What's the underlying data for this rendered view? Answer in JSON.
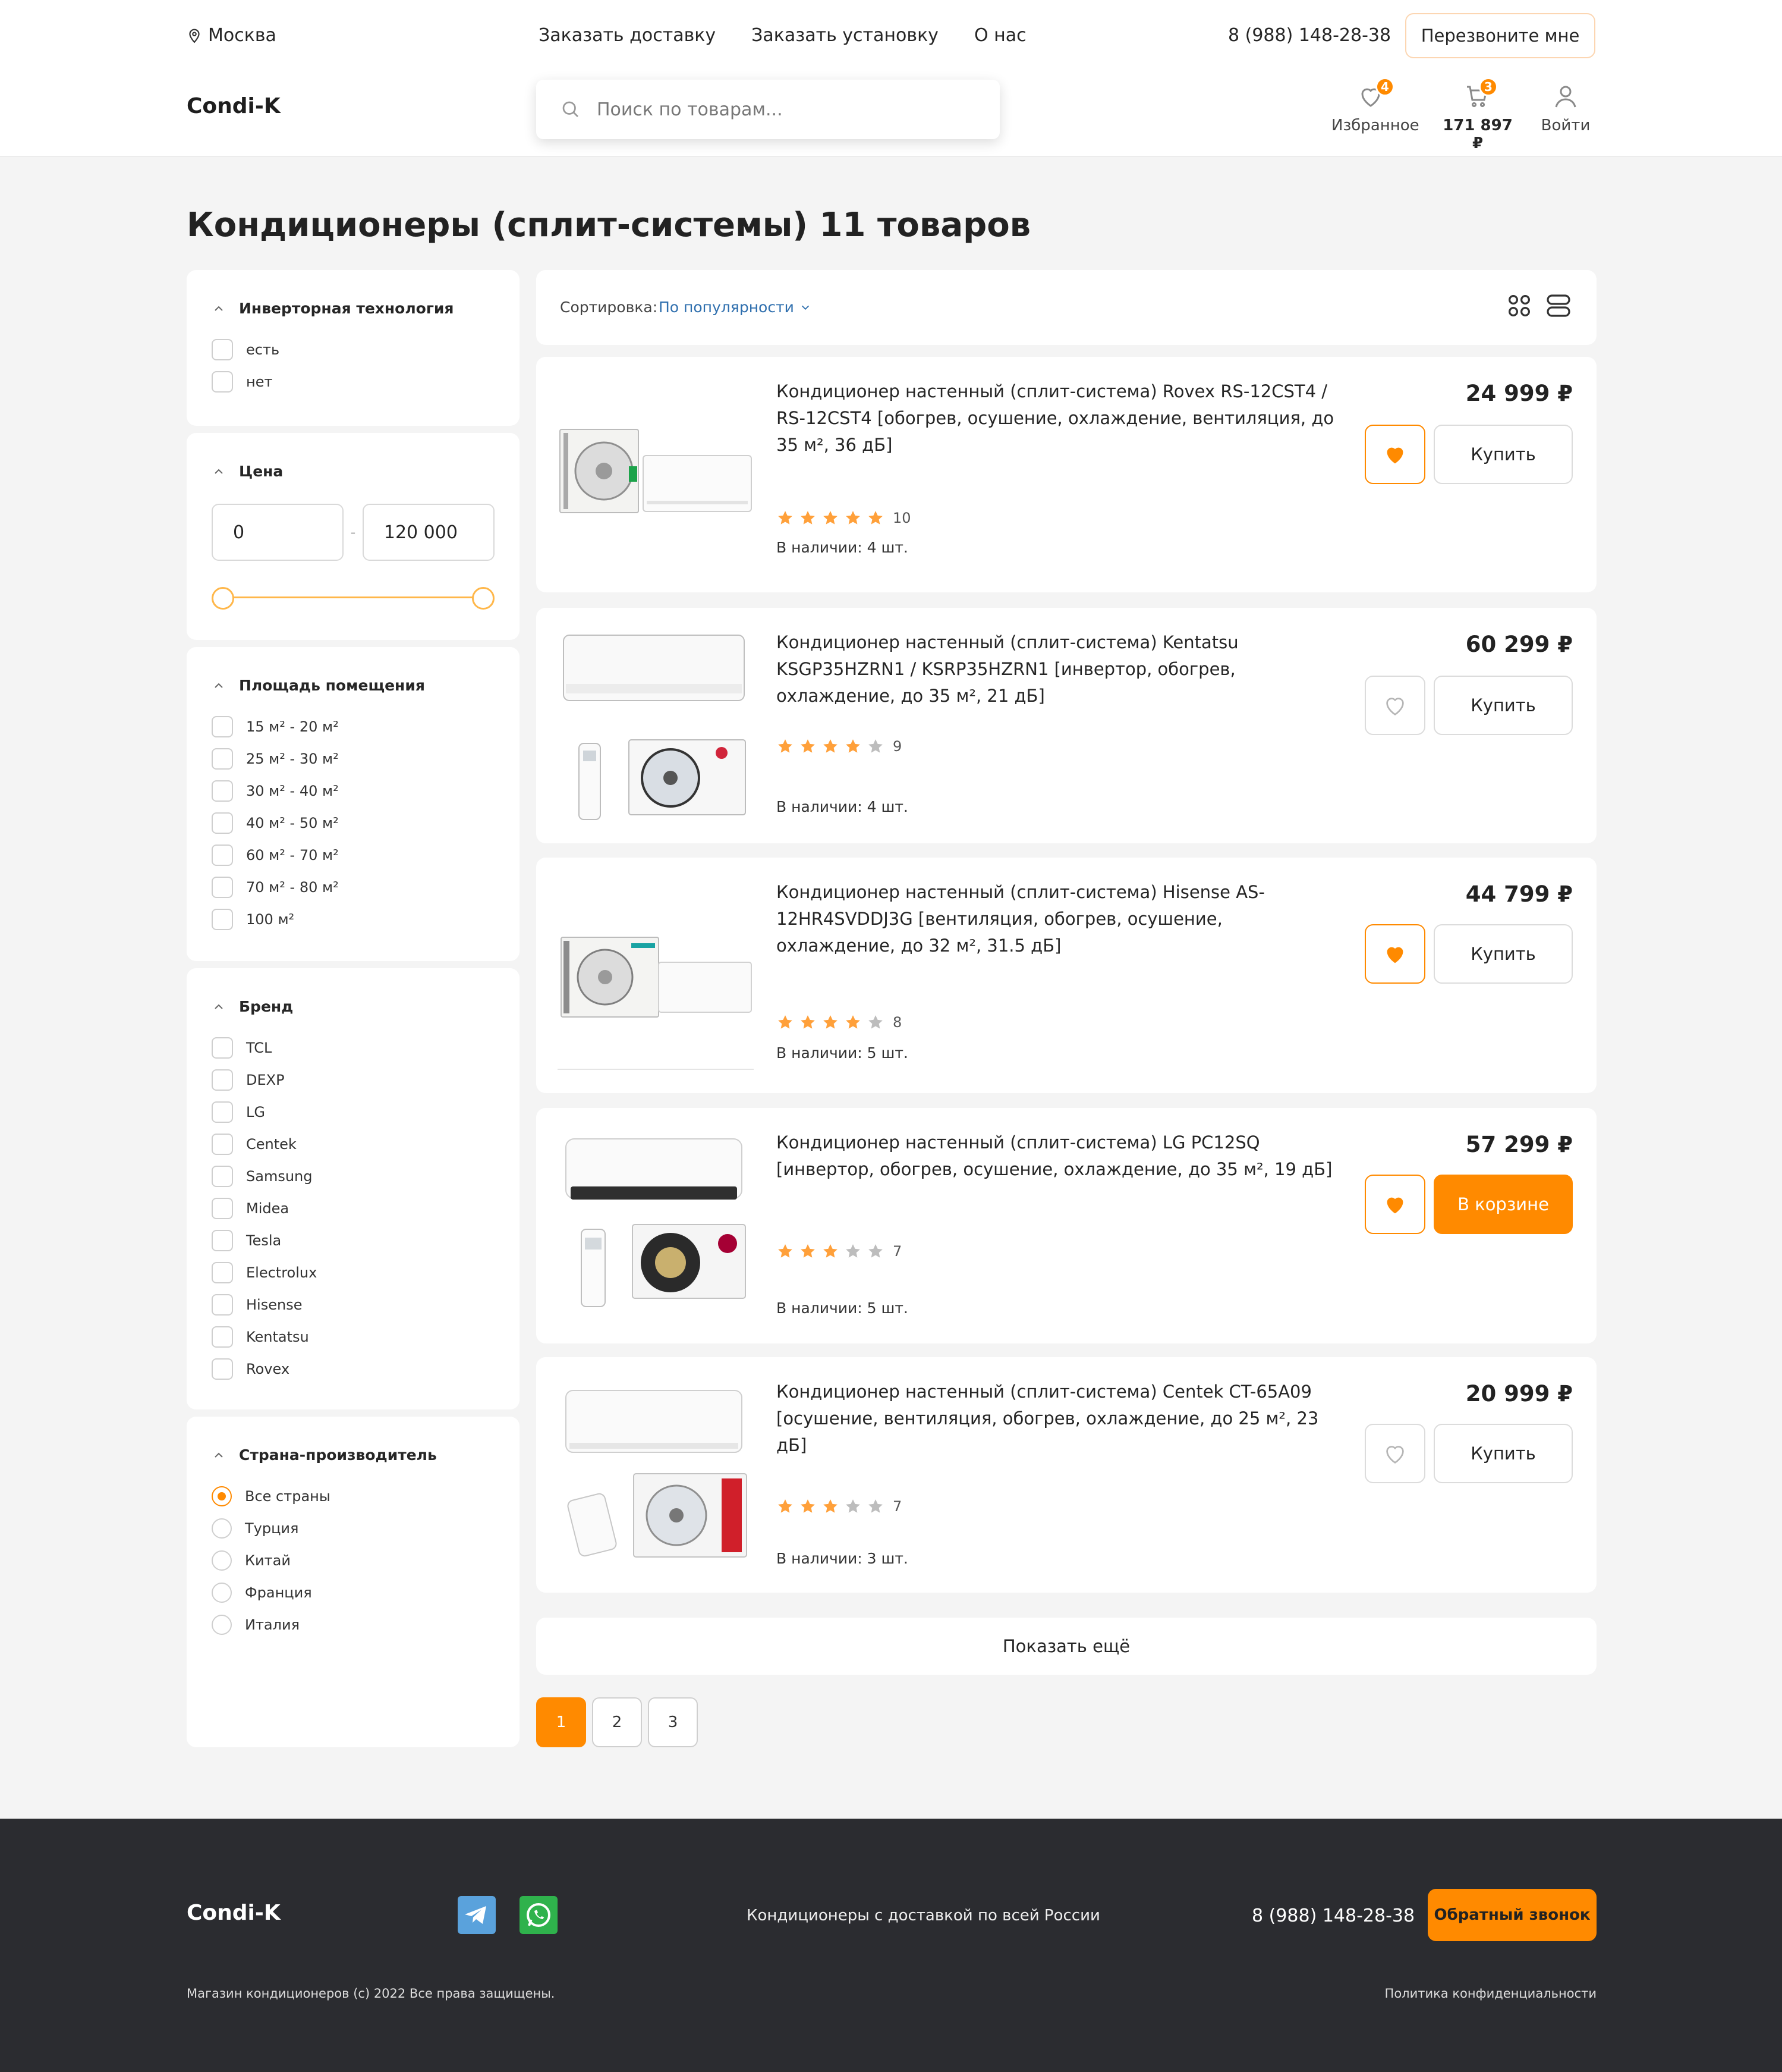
{
  "header": {
    "city": "Москва",
    "nav": [
      "Заказать доставку",
      "Заказать установку",
      "О нас"
    ],
    "phone": "8 (988) 148-28-38",
    "callback_label": "Перезвоните мне",
    "logo": "Condi-K",
    "search_placeholder": "Поиск по товарам...",
    "favorites": {
      "label": "Избранное",
      "count": "4",
      "icon": "heart-icon"
    },
    "cart": {
      "label": "171 897 ₽",
      "count": "3",
      "icon": "cart-icon"
    },
    "login": {
      "label": "Войти",
      "icon": "user-icon"
    }
  },
  "page_title": "Кондиционеры (сплит-системы) 11 товаров",
  "filters": {
    "inverter": {
      "title": "Инверторная технология",
      "options": [
        "есть",
        "нет"
      ]
    },
    "price": {
      "title": "Цена",
      "min": "0",
      "max": "120 000",
      "range_fraction": [
        0,
        1
      ]
    },
    "area": {
      "title": "Площадь помещения",
      "options": [
        "15 м² - 20 м²",
        "25 м² - 30 м²",
        "30 м² - 40 м²",
        "40 м² - 50 м²",
        "60 м² - 70 м²",
        "70 м² - 80 м²",
        "100 м²"
      ]
    },
    "brand": {
      "title": "Бренд",
      "options": [
        "TCL",
        "DEXP",
        "LG",
        "Centek",
        "Samsung",
        "Midea",
        "Tesla",
        "Electrolux",
        "Hisense",
        "Kentatsu",
        "Rovex"
      ]
    },
    "country": {
      "title": "Страна-производитель",
      "options": [
        "Все страны",
        "Турция",
        "Китай",
        "Франция",
        "Италия"
      ],
      "selected": "Все страны"
    }
  },
  "toolbar": {
    "sort_label": "Сортировка:",
    "sort_value": "По популярности",
    "view_icons": [
      "grid-view-icon",
      "list-view-icon"
    ]
  },
  "products": [
    {
      "name": "Кондиционер настенный (сплит-система) Rovex RS-12CST4 / RS-12CST4 [обогрев, осушение, охлаждение, вентиляция, до 35 м², 36 дБ]",
      "price": "24 999 ₽",
      "rating": 5,
      "reviews": "10",
      "stock": "В наличии: 4 шт.",
      "favorite": true,
      "buy_label": "Купить",
      "in_cart": false
    },
    {
      "name": "Кондиционер настенный (сплит-система) Kentatsu KSGP35HZRN1 / KSRP35HZRN1 [инвертор, обогрев, охлаждение, до 35 м², 21 дБ]",
      "price": "60 299 ₽",
      "rating": 4,
      "reviews": "9",
      "stock": "В наличии: 4 шт.",
      "favorite": false,
      "buy_label": "Купить",
      "in_cart": false
    },
    {
      "name": "Кондиционер настенный (сплит-система) Hisense AS-12HR4SVDDJ3G [вентиляция, обогрев, осушение, охлаждение, до 32 м², 31.5 дБ]",
      "price": "44 799 ₽",
      "rating": 4,
      "reviews": "8",
      "stock": "В наличии: 5 шт.",
      "favorite": true,
      "buy_label": "Купить",
      "in_cart": false
    },
    {
      "name": "Кондиционер настенный (сплит-система) LG PC12SQ [инвертор, обогрев, осушение, охлаждение, до 35 м², 19 дБ]",
      "price": "57 299 ₽",
      "rating": 3,
      "reviews": "7",
      "stock": "В наличии: 5 шт.",
      "favorite": true,
      "buy_label": "В корзине",
      "in_cart": true
    },
    {
      "name": "Кондиционер настенный (сплит-система) Centek CT-65A09 [осушение, вентиляция, обогрев, охлаждение, до 25 м², 23 дБ]",
      "price": "20 999 ₽",
      "rating": 3,
      "reviews": "7",
      "stock": "В наличии: 3 шт.",
      "favorite": false,
      "buy_label": "Купить",
      "in_cart": false
    }
  ],
  "show_more": "Показать ещё",
  "pagination": {
    "pages": [
      "1",
      "2",
      "3"
    ],
    "current": "1"
  },
  "footer": {
    "logo": "Condi-K",
    "social": [
      "telegram-icon",
      "whatsapp-icon"
    ],
    "tagline": "Кондиционеры с доставкой по всей России",
    "phone": "8 (988) 148-28-38",
    "callback_label": "Обратный звонок",
    "copyright": "Магазин кондиционеров (с) 2022 Все права защищены.",
    "privacy": "Политика конфиденциальности"
  },
  "colors": {
    "accent": "#ff8a00",
    "footer_bg": "#2b2c30",
    "link": "#2f6fae",
    "star_on": "#ffa03a",
    "star_off": "#bdbdbd"
  }
}
